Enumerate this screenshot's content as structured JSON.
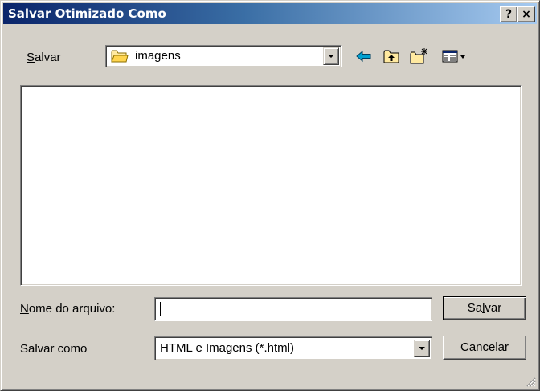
{
  "window": {
    "title": "Salvar Otimizado Como"
  },
  "titlebar_buttons": {
    "help": "?",
    "close": "×"
  },
  "location": {
    "label_first": "S",
    "label_rest": "alvar",
    "value": "imagens"
  },
  "filename": {
    "label_first": "N",
    "label_rest": "ome do arquivo:",
    "value": ""
  },
  "filetype": {
    "label": "Salvar como",
    "value": "HTML e Imagens (*.html)"
  },
  "buttons": {
    "save_pre": "Sa",
    "save_ul": "l",
    "save_post": "var",
    "cancel": "Cancelar"
  },
  "icons": [
    "folder-icon",
    "back-arrow-icon",
    "up-folder-icon",
    "new-folder-icon",
    "view-menu-icon"
  ],
  "colors": {
    "titlebar_start": "#0a246a",
    "titlebar_end": "#a6caf0",
    "face": "#d4d0c8"
  }
}
